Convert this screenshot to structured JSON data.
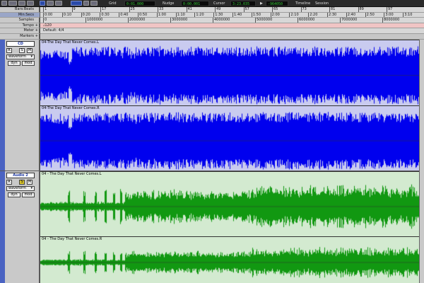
{
  "toolbar": {
    "grid_label": "Grid",
    "grid_value": "0:01.000",
    "nudge_label": "Nudge",
    "nudge_value": "0:00.001",
    "cursor_label": "Cursor",
    "cursor_value": "3:23.035",
    "readout_value": "-964050",
    "timeline_label": "Timeline",
    "session_label": "Session"
  },
  "rulers": {
    "labels": [
      "Bars:Beats",
      "Min:Secs",
      "Samples",
      "Tempo",
      "Meter",
      "Markers"
    ],
    "bars": [
      "1",
      "9",
      "17",
      "25",
      "33",
      "41",
      "49",
      "57",
      "65",
      "73",
      "81",
      "89",
      "97"
    ],
    "minsecs": [
      "0:00",
      "0:10",
      "0:20",
      "0:30",
      "0:40",
      "0:50",
      "1:00",
      "1:10",
      "1:20",
      "1:30",
      "1:40",
      "1:50",
      "2:00",
      "2:10",
      "2:20",
      "2:30",
      "2:40",
      "2:50",
      "3:00",
      "3:10"
    ],
    "samples": [
      "0",
      "1000000",
      "2000000",
      "3000000",
      "4000000",
      "5000000",
      "6000000",
      "7000000",
      "8000000"
    ],
    "tempo_value": "♩120",
    "meter_value": "Default: 4/4"
  },
  "tracks": [
    {
      "name": "CD",
      "rec": "R",
      "solo": "S",
      "mute": "M",
      "view": "waveform",
      "dyn": "dyn",
      "mod": "mod",
      "regions": [
        "04-The Day That Never Comes.L",
        "04-The Day That Never Comes.R"
      ],
      "wave_color": "#0000ee",
      "bg_color": "#c9cbef",
      "solo_active": false
    },
    {
      "name": "Audio 2",
      "rec": "R",
      "solo": "S",
      "mute": "M",
      "view": "waveform",
      "dyn": "dyn",
      "mod": "mod",
      "regions": [
        "04 - The Day That Never Comes.L",
        "04 - The Day That Never Comes.R"
      ],
      "wave_color": "#119811",
      "bg_color": "#d3ead0",
      "solo_active": true
    }
  ]
}
